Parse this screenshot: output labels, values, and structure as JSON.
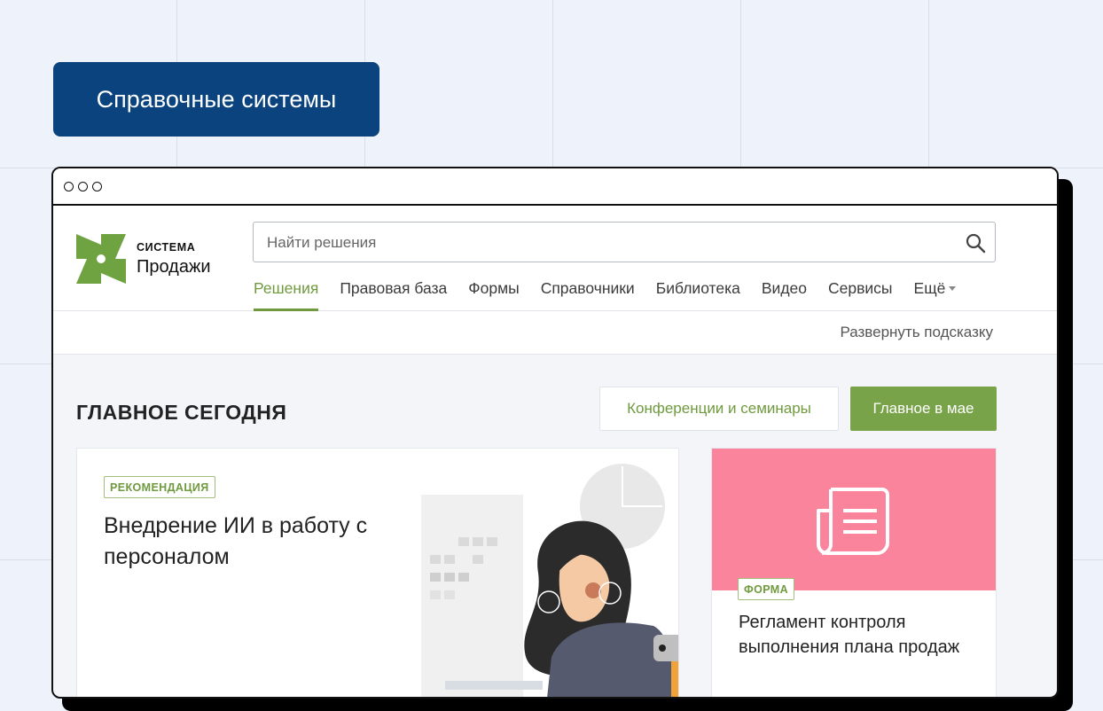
{
  "banner": {
    "label": "Справочные системы"
  },
  "brand": {
    "line1": "СИСТЕМА",
    "line2": "Продажи"
  },
  "search": {
    "placeholder": "Найти решения"
  },
  "nav": {
    "items": [
      "Решения",
      "Правовая база",
      "Формы",
      "Справочники",
      "Библиотека",
      "Видео",
      "Сервисы"
    ],
    "more": "Ещё",
    "active_index": 0
  },
  "hint": "Развернуть подсказку",
  "section": {
    "title": "ГЛАВНОЕ СЕГОДНЯ",
    "btn_conferences": "Конференции и семинары",
    "btn_main_month": "Главное в мае"
  },
  "cards": {
    "main": {
      "badge": "РЕКОМЕНДАЦИЯ",
      "title": "Внедрение ИИ в работу с персоналом"
    },
    "side": {
      "badge": "ФОРМА",
      "title": "Регламент контроля выполнения плана продаж"
    }
  },
  "colors": {
    "brand_blue": "#0a437e",
    "accent_green": "#78a348",
    "card_pink": "#f9849c"
  }
}
